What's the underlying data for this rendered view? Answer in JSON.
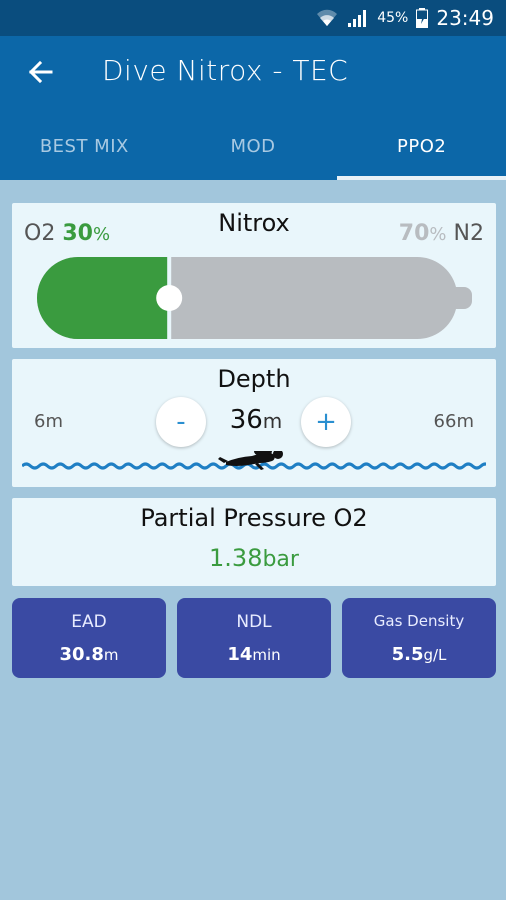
{
  "status_bar": {
    "battery": "45%",
    "time": "23:49",
    "icons": [
      "wifi-icon",
      "signal-icon",
      "battery-icon"
    ]
  },
  "app_bar": {
    "title": "Dive Nitrox - TEC",
    "back_icon": "arrow-left-icon"
  },
  "tabs": [
    {
      "label": "BEST MIX",
      "active": false
    },
    {
      "label": "MOD",
      "active": false
    },
    {
      "label": "PPO2",
      "active": true
    }
  ],
  "nitrox": {
    "title": "Nitrox",
    "o2_label": "O2",
    "o2_value": "30",
    "o2_unit": "%",
    "n2_value": "70",
    "n2_unit": "%",
    "n2_label": "N2",
    "o2_fraction": 0.3
  },
  "depth": {
    "title": "Depth",
    "min": "6m",
    "max": "66m",
    "value": "36",
    "unit": "m",
    "minus_label": "-",
    "plus_label": "+"
  },
  "ppo2": {
    "title": "Partial Pressure O2",
    "value": "1.38",
    "unit": "bar"
  },
  "stats": {
    "ead": {
      "label": "EAD",
      "value": "30.8",
      "unit": "m"
    },
    "ndl": {
      "label": "NDL",
      "value": "14",
      "unit": "min"
    },
    "gas_density": {
      "label": "Gas Density",
      "value": "5.5",
      "unit": "g/L"
    }
  },
  "colors": {
    "status_bar": "#0a4d7e",
    "app_bar": "#0c67a8",
    "background": "#a2c6dc",
    "card": "#e9f6fb",
    "o2_green": "#3a9b3f",
    "n2_grey": "#b8bcc0",
    "stat_box": "#3a4aa3",
    "wave": "#1f7fc4"
  }
}
